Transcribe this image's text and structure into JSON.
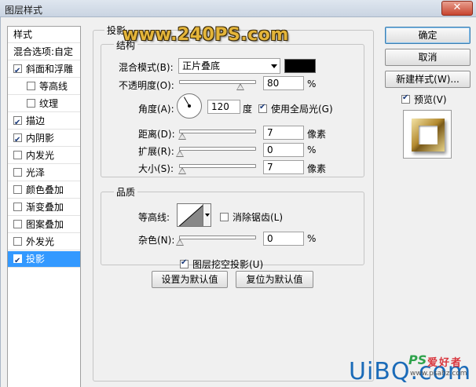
{
  "window": {
    "title": "图层样式",
    "close": "✕"
  },
  "watermark": "www.240PS.com",
  "style_list": {
    "items": [
      {
        "label": "样式",
        "type": "header"
      },
      {
        "label": "混合选项:自定",
        "type": "header"
      },
      {
        "label": "斜面和浮雕",
        "checked": true
      },
      {
        "label": "等高线",
        "checked": false,
        "indent": true
      },
      {
        "label": "纹理",
        "checked": false,
        "indent": true
      },
      {
        "label": "描边",
        "checked": true
      },
      {
        "label": "内阴影",
        "checked": true
      },
      {
        "label": "内发光",
        "checked": false
      },
      {
        "label": "光泽",
        "checked": false
      },
      {
        "label": "颜色叠加",
        "checked": false
      },
      {
        "label": "渐变叠加",
        "checked": false
      },
      {
        "label": "图案叠加",
        "checked": false
      },
      {
        "label": "外发光",
        "checked": false
      },
      {
        "label": "投影",
        "checked": true,
        "selected": true
      }
    ]
  },
  "drop_shadow": {
    "section_title": "投影",
    "structure": {
      "title": "结构",
      "blend_mode_label": "混合模式(B):",
      "blend_mode_value": "正片叠底",
      "blend_color": "#000000",
      "opacity_label": "不透明度(O):",
      "opacity_value": "80",
      "opacity_unit": "%",
      "opacity_level": 0.8,
      "angle_label": "角度(A):",
      "angle_value": "120",
      "angle_unit": "度",
      "global_light_label": "使用全局光(G)",
      "global_light_checked": true,
      "distance_label": "距离(D):",
      "distance_value": "7",
      "distance_unit": "像素",
      "distance_level": 0.03,
      "spread_label": "扩展(R):",
      "spread_value": "0",
      "spread_unit": "%",
      "spread_level": 0,
      "size_label": "大小(S):",
      "size_value": "7",
      "size_unit": "像素",
      "size_level": 0.03
    },
    "quality": {
      "title": "品质",
      "contour_label": "等高线:",
      "anti_alias_label": "消除锯齿(L)",
      "anti_alias_checked": false,
      "noise_label": "杂色(N):",
      "noise_value": "0",
      "noise_unit": "%",
      "noise_level": 0
    },
    "knockout_label": "图层挖空投影(U)",
    "knockout_checked": true,
    "set_default": "设置为默认值",
    "reset_default": "复位为默认值"
  },
  "buttons": {
    "ok": "确定",
    "cancel": "取消",
    "new_style": "新建样式(W)...",
    "preview_label": "预览(V)",
    "preview_checked": true
  },
  "corner_logo": {
    "main": "UiBQ.com",
    "ps": "PS",
    "cn": "爱好者",
    "url": "www.psahz.com"
  }
}
